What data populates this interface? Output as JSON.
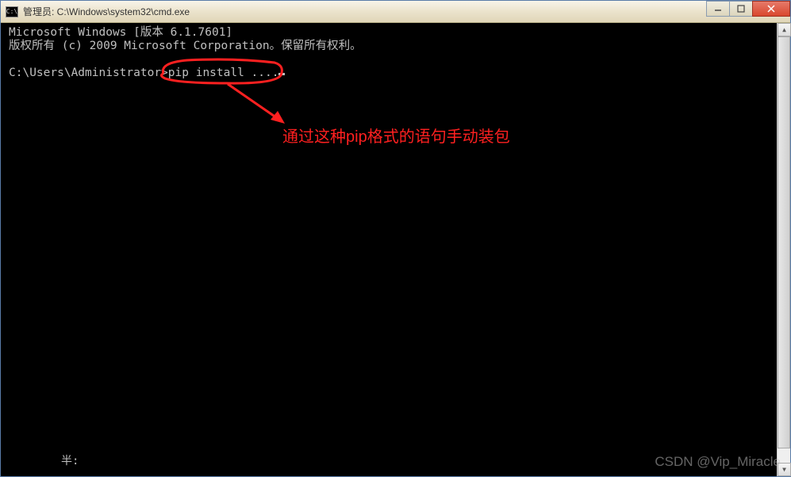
{
  "window": {
    "icon_text": "C:\\",
    "title": "管理员: C:\\Windows\\system32\\cmd.exe"
  },
  "terminal": {
    "line1": "Microsoft Windows [版本 6.1.7601]",
    "line2": "版权所有 (c) 2009 Microsoft Corporation。保留所有权利。",
    "prompt": "C:\\Users\\Administrator>",
    "command": "pip install ...."
  },
  "annotation": {
    "text": "通过这种pip格式的语句手动装包",
    "color": "#ff2020"
  },
  "footer": {
    "text": "半:"
  },
  "watermark": "CSDN @Vip_Miracle"
}
